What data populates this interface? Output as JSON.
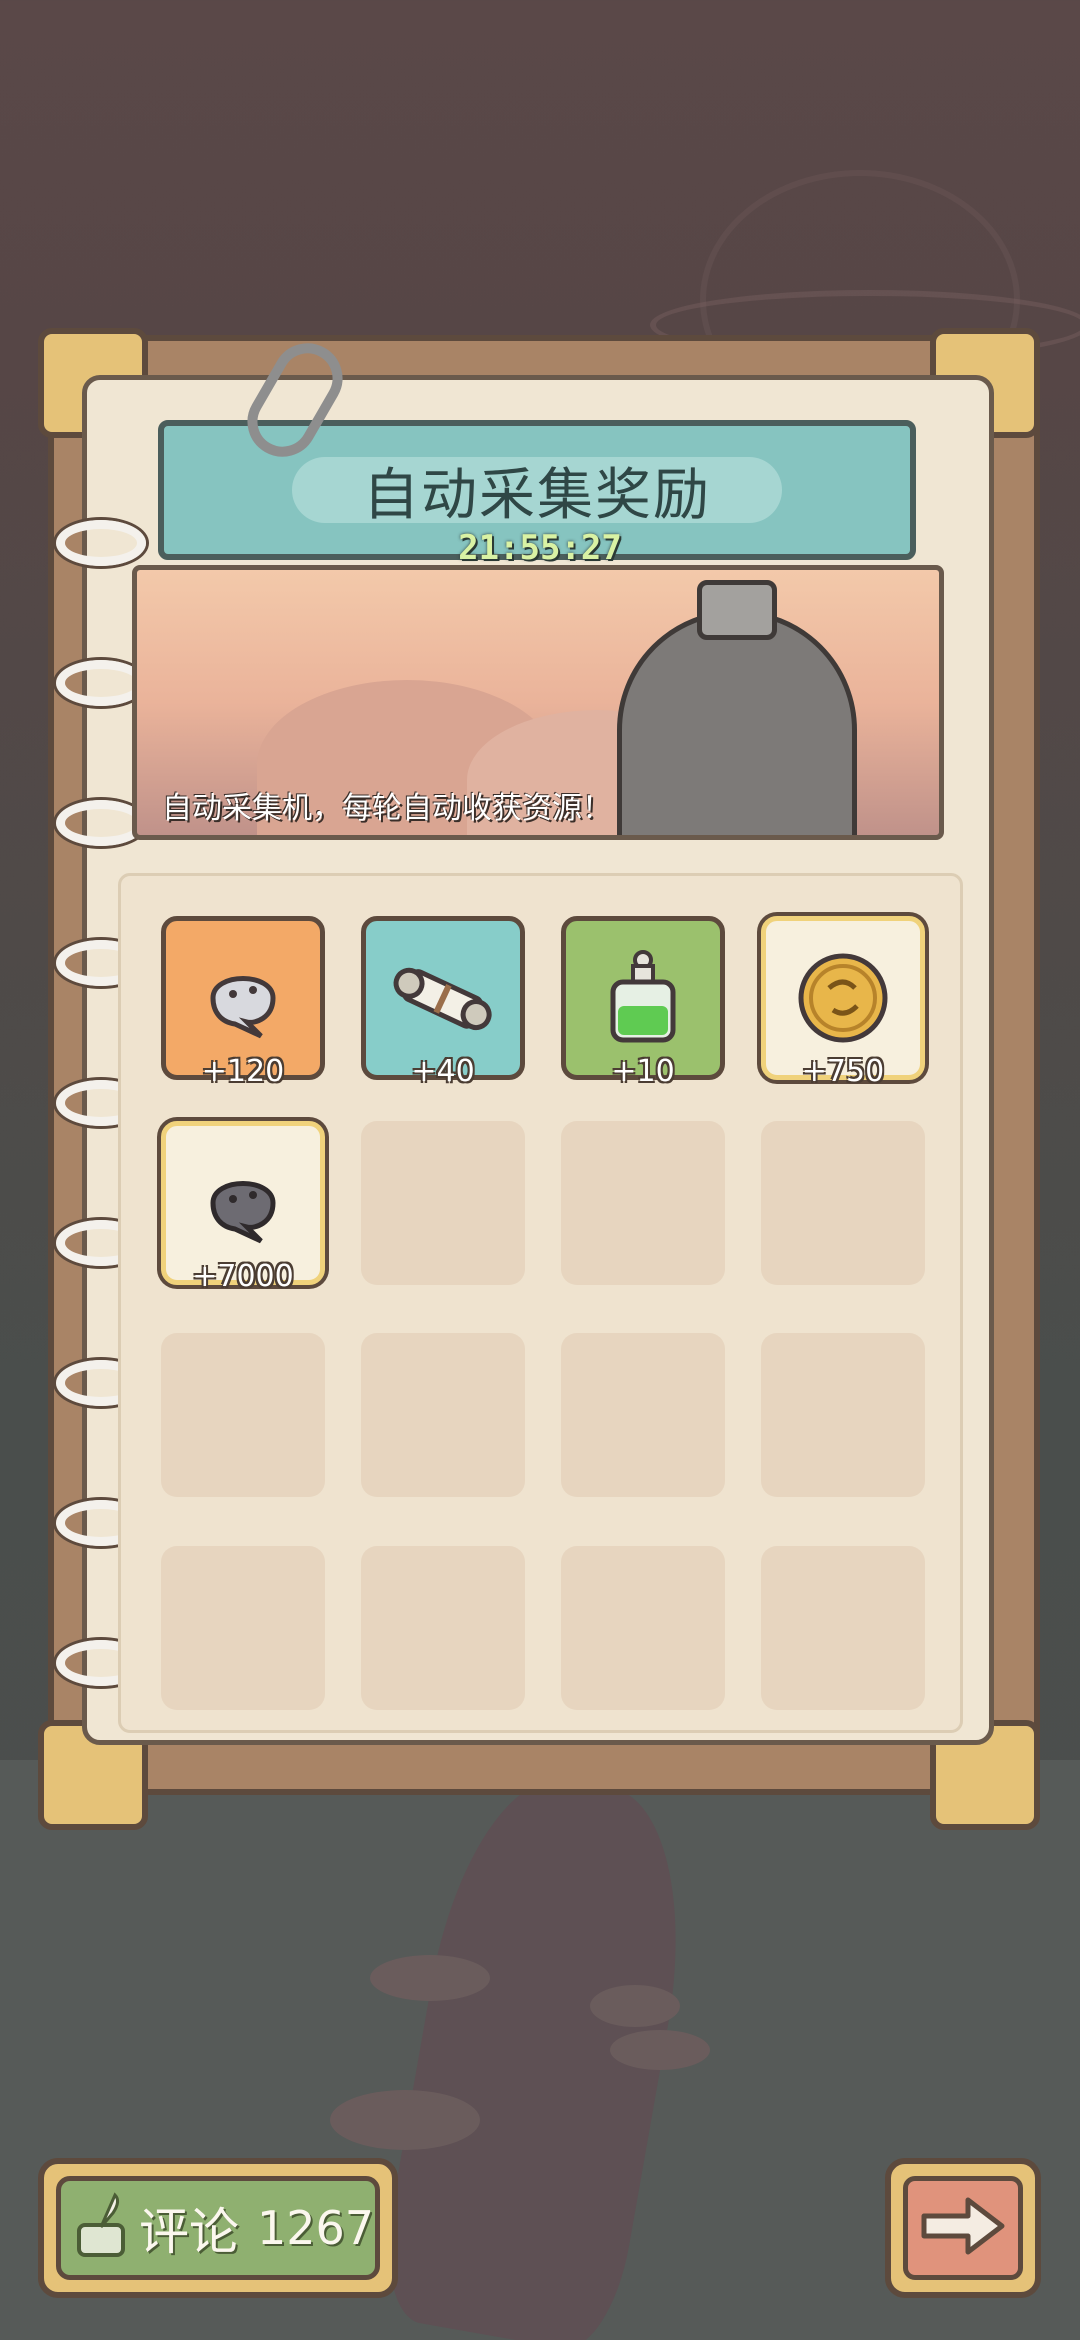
{
  "panel": {
    "title": "自动采集奖励",
    "timer": "21:55:27",
    "caption": "自动采集机，每轮自动收获资源！"
  },
  "rewards": [
    {
      "icon": "gray-blob-icon",
      "count": "+120",
      "bg": "#f3a967"
    },
    {
      "icon": "scroll-icon",
      "count": "+40",
      "bg": "#87cdc9"
    },
    {
      "icon": "potion-bottle-icon",
      "count": "+10",
      "bg": "#9bc16d"
    },
    {
      "icon": "gold-coin-icon",
      "count": "+750",
      "bg": "#f7f0de"
    },
    {
      "icon": "dark-blob-icon",
      "count": "+7000",
      "bg": "#f7f0de"
    }
  ],
  "footer": {
    "comment_label": "评论",
    "comment_count": "1267",
    "next_icon": "arrow-right-icon"
  },
  "colors": {
    "frame": "#a98466",
    "page": "#f0e6d3",
    "banner": "#86c4c0",
    "timer": "#d9f2a4",
    "comment_button": "#8fb070",
    "next_button": "#e0937c"
  }
}
